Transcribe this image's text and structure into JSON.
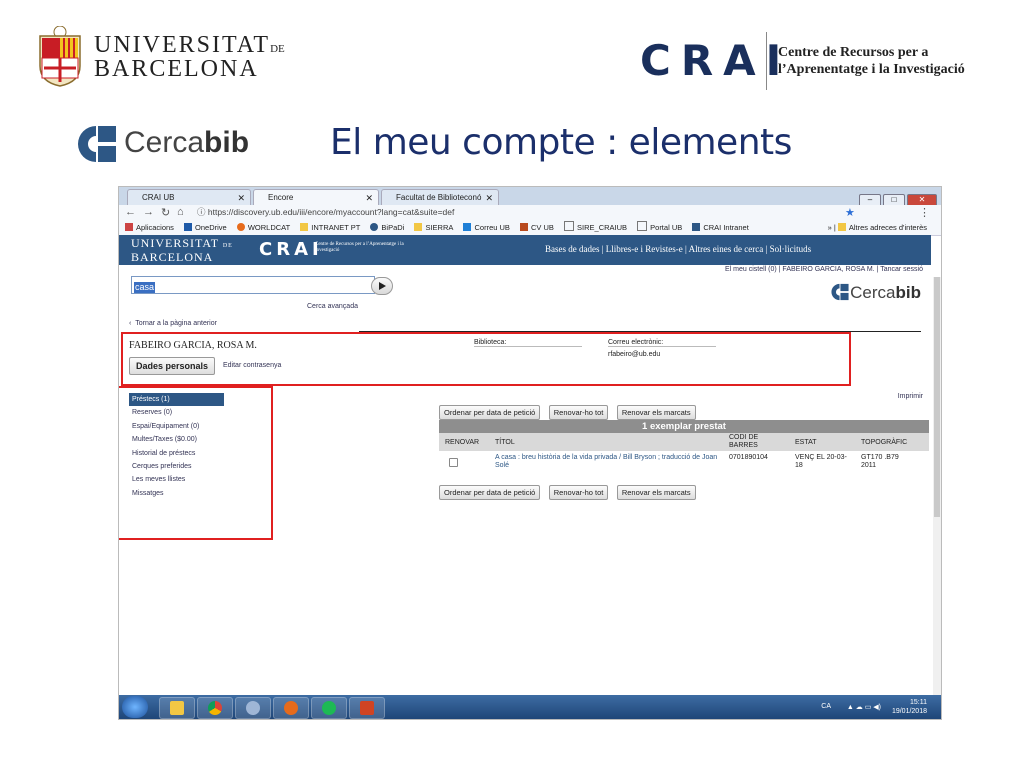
{
  "slide": {
    "ub_line1": "UNIVERSITAT",
    "ub_de": "DE",
    "ub_line2": "BARCELONA",
    "crai": "CRAI",
    "crai_desc_1": "Centre de Recursos per a",
    "crai_desc_2": "l’Aprenentatge i la Investigació",
    "cercabib_light": "Cerca",
    "cercabib_bold": "bib",
    "title": "El meu compte : elements"
  },
  "browser": {
    "tabs": [
      "CRAI UB",
      "Encore",
      "Facultat de Biblioteconó"
    ],
    "url": "https://discovery.ub.edu/iii/encore/myaccount?lang=cat&suite=def",
    "bookmarks": [
      "Aplicacions",
      "OneDrive",
      "WORLDCAT",
      "INTRANET PT",
      "BiPaDi",
      "SIERRA",
      "Correu UB",
      "CV UB",
      "SIRE_CRAIUB",
      "Portal UB",
      "CRAI Intranet"
    ],
    "other_bookmarks": "Altres adreces d'interès"
  },
  "site": {
    "ub_1": "UNIVERSITAT",
    "ub_de": "DE",
    "ub_2": "BARCELONA",
    "crai": "CRAI",
    "crai_desc": "Centre de Recursos per a l’Aprenentatge i la Investigació",
    "nav": "Bases de dades  |  Llibres-e i Revistes-e  |  Altres eines de cerca  |  Sol·licituds",
    "userline": "El meu cistell (0)  |  FABEIRO GARCIA, ROSA M.  |  Tancar sessió",
    "search_value": "casa",
    "advanced_search": "Cerca avançada",
    "back": "Tornar a la pàgina anterior",
    "patron_name": "FABEIRO GARCIA, ROSA M.",
    "dades_btn": "Dades personals",
    "edit_pw": "Editar contrasenya",
    "biblioteca_label": "Biblioteca:",
    "email_label": "Correu electrònic:",
    "email_value": "rfabeiro@ub.edu",
    "print": "Imprimir"
  },
  "sidenav": [
    "Préstecs (1)",
    "Reserves (0)",
    "Espai/Equipament (0)",
    "Multes/Taxes ($0.00)",
    "Historial de préstecs",
    "Cerques preferides",
    "Les meves llistes",
    "Missatges"
  ],
  "loans": {
    "actions": [
      "Ordenar per data de petició",
      "Renovar-ho tot",
      "Renovar els marcats"
    ],
    "header": "1 exemplar prestat",
    "columns": [
      "RENOVAR",
      "TÍTOL",
      "CODI DE BARRES",
      "ESTAT",
      "TOPOGRÀFIC"
    ],
    "rows": [
      {
        "title": "A casa : breu història de la vida privada / Bill Bryson ; traducció de Joan Solé",
        "barcode": "0701890104",
        "status": "VENÇ EL 20-03-18",
        "call": "GT170 .B79 2011"
      }
    ]
  },
  "taskbar": {
    "lang": "CA",
    "time": "15:11",
    "date": "19/01/2018"
  }
}
